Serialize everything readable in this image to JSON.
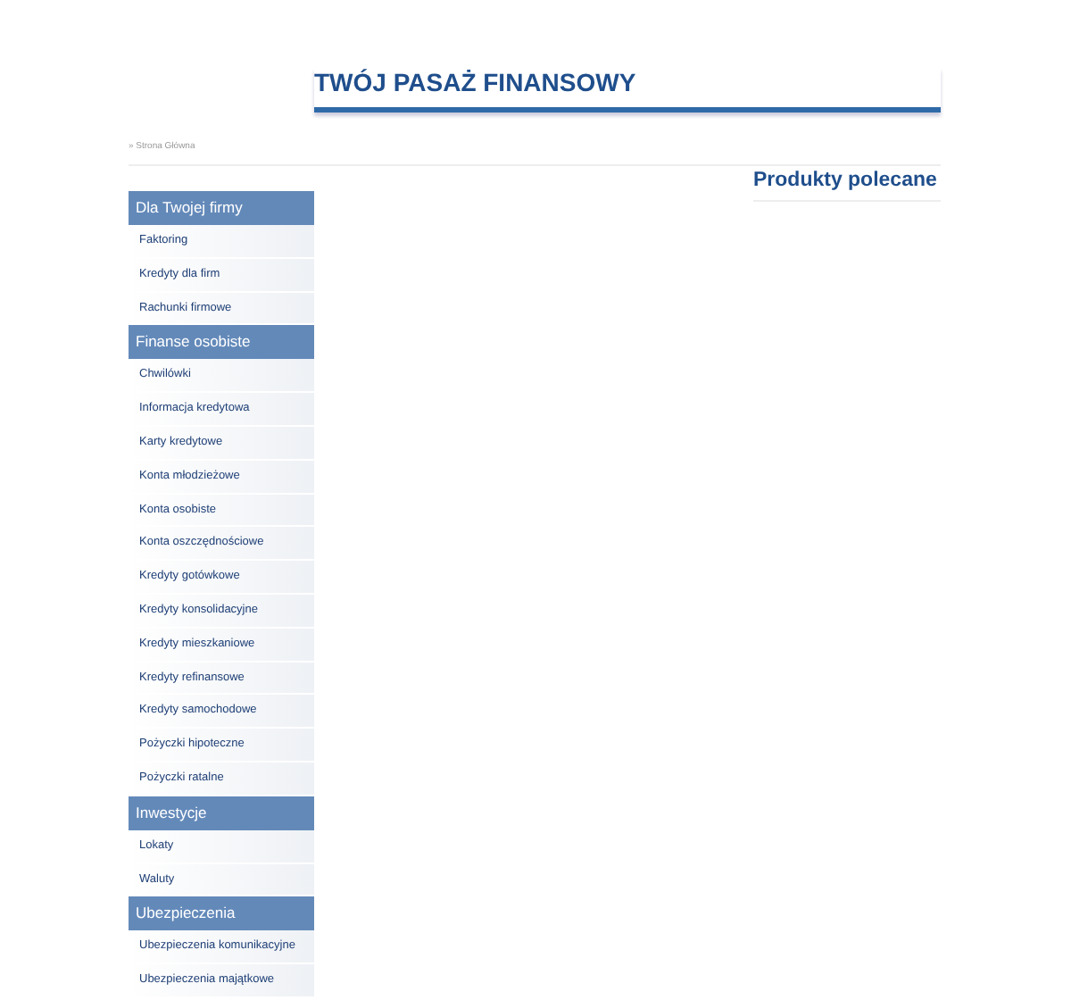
{
  "header": {
    "title": "TWÓJ PASAŻ FINANSOWY"
  },
  "breadcrumb": "» Strona Główna",
  "sidebar": [
    {
      "title": "Dla Twojej firmy",
      "items": [
        "Faktoring",
        "Kredyty dla firm",
        "Rachunki firmowe"
      ]
    },
    {
      "title": "Finanse osobiste",
      "items": [
        "Chwilówki",
        "Informacja kredytowa",
        "Karty kredytowe",
        "Konta młodzieżowe",
        "Konta osobiste",
        "Konta oszczędnościowe",
        "Kredyty gotówkowe",
        "Kredyty konsolidacyjne",
        "Kredyty mieszkaniowe",
        "Kredyty refinansowe",
        "Kredyty samochodowe",
        "Pożyczki hipoteczne",
        "Pożyczki ratalne"
      ]
    },
    {
      "title": "Inwestycje",
      "items": [
        "Lokaty",
        "Waluty"
      ]
    },
    {
      "title": "Ubezpieczenia",
      "items": [
        "Ubezpieczenia komunikacyjne",
        "Ubezpieczenia majątkowe"
      ]
    }
  ],
  "featured": {
    "title": "Produkty polecane"
  }
}
